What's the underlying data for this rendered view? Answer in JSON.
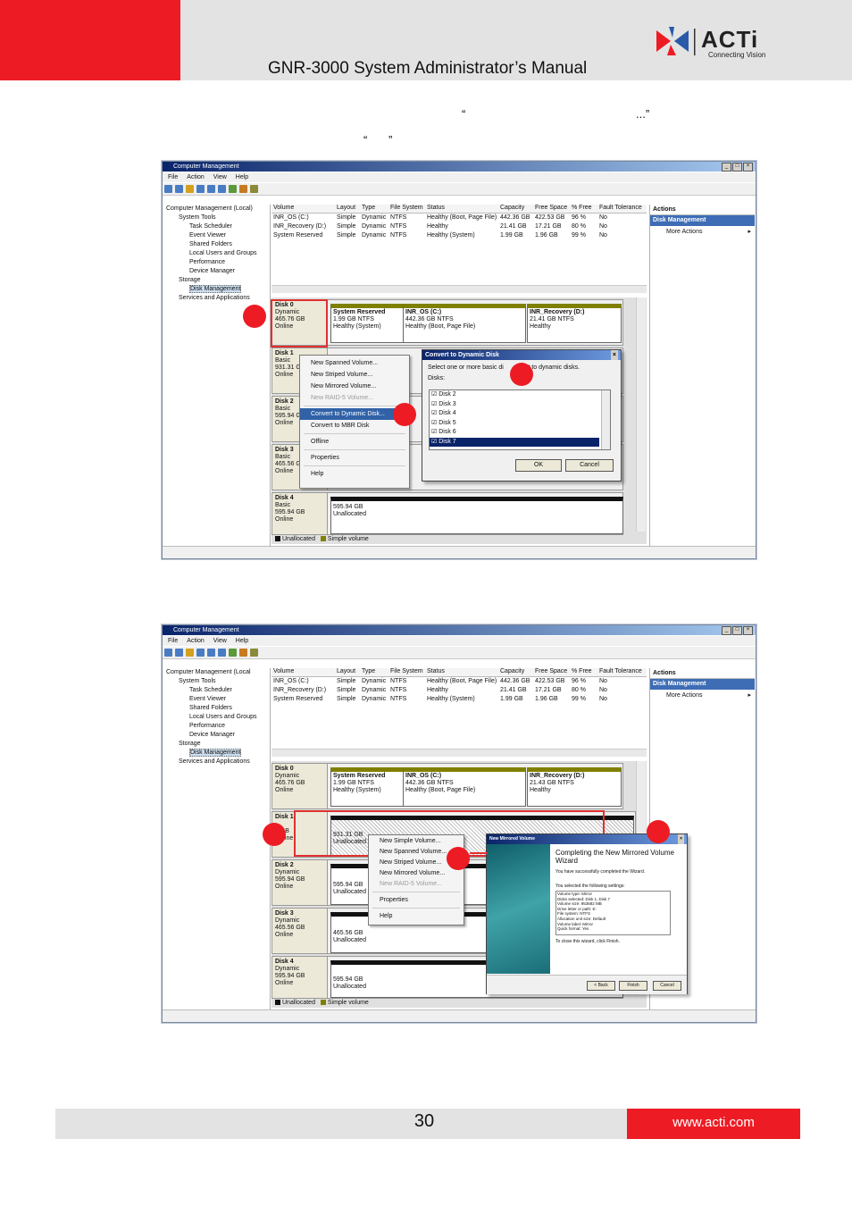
{
  "header": {
    "title": "GNR-3000 System Administrator’s Manual"
  },
  "logo": {
    "brand": "ACTi",
    "tagline": "Connecting Vision"
  },
  "body_text": {
    "open_quote_1": "“",
    "close_quote_1": "...”",
    "open_quote_2": "“",
    "close_quote_2": "”"
  },
  "footer": {
    "page_number": "30",
    "url": "www.acti.com"
  },
  "screenshot1": {
    "window_title": "Computer Management",
    "menu": [
      "File",
      "Action",
      "View",
      "Help"
    ],
    "tree": [
      "Computer Management (Local)",
      "System Tools",
      "Task Scheduler",
      "Event Viewer",
      "Shared Folders",
      "Local Users and Groups",
      "Performance",
      "Device Manager",
      "Storage",
      "Disk Management",
      "Services and Applications"
    ],
    "columns": [
      "Volume",
      "Layout",
      "Type",
      "File System",
      "Status",
      "Capacity",
      "Free Space",
      "% Free",
      "Fault Tolerance"
    ],
    "rows": [
      [
        "INR_OS (C:)",
        "Simple",
        "Dynamic",
        "NTFS",
        "Healthy (Boot, Page File)",
        "442.36 GB",
        "422.53 GB",
        "96 %",
        "No"
      ],
      [
        "INR_Recovery (D:)",
        "Simple",
        "Dynamic",
        "NTFS",
        "Healthy",
        "21.41 GB",
        "17.21 GB",
        "80 %",
        "No"
      ],
      [
        "System Reserved",
        "Simple",
        "Dynamic",
        "NTFS",
        "Healthy (System)",
        "1.99 GB",
        "1.96 GB",
        "99 %",
        "No"
      ]
    ],
    "actions": {
      "header": "Actions",
      "selected": "Disk Management",
      "more": "More Actions"
    },
    "disk0": {
      "name": "Disk 0",
      "type": "Dynamic",
      "size": "465.76 GB",
      "status": "Online",
      "parts": [
        {
          "name": "System Reserved",
          "size": "1.99 GB NTFS",
          "status": "Healthy (System)"
        },
        {
          "name": "INR_OS (C:)",
          "size": "442.36 GB NTFS",
          "status": "Healthy (Boot, Page File)"
        },
        {
          "name": "INR_Recovery (D:)",
          "size": "21.41 GB NTFS",
          "status": "Healthy"
        }
      ]
    },
    "disk1": {
      "name": "Disk 1",
      "type": "Basic",
      "size": "931.31 G",
      "status": "Online"
    },
    "disk2": {
      "name": "Disk 2",
      "type": "Basic",
      "size": "595.94 G",
      "status": "Online"
    },
    "disk3": {
      "name": "Disk 3",
      "type": "Basic",
      "size": "465.56 G",
      "status": "Online"
    },
    "disk4": {
      "name": "Disk 4",
      "type": "Basic",
      "size": "595.94 GB",
      "status": "Online",
      "part_size": "595.94 GB",
      "part_status": "Unallocated"
    },
    "context_menu": [
      "New Spanned Volume...",
      "New Striped Volume...",
      "New Mirrored Volume...",
      "New RAID-5 Volume...",
      "Convert to Dynamic Disk...",
      "Convert to MBR Disk",
      "Offline",
      "Properties",
      "Help"
    ],
    "dialog": {
      "title": "Convert to Dynamic Disk",
      "prompt": "Select one or more basic di",
      "prompt_tail": "nvert to dynamic disks.",
      "disks_label": "Disks:",
      "disks": [
        "Disk 2",
        "Disk 3",
        "Disk 4",
        "Disk 5",
        "Disk 6",
        "Disk 7"
      ],
      "ok": "OK",
      "cancel": "Cancel"
    },
    "legend": [
      "Unallocated",
      "Simple volume"
    ]
  },
  "screenshot2": {
    "window_title": "Computer Management",
    "menu": [
      "File",
      "Action",
      "View",
      "Help"
    ],
    "tree": [
      "Computer Management (Local",
      "System Tools",
      "Task Scheduler",
      "Event Viewer",
      "Shared Folders",
      "Local Users and Groups",
      "Performance",
      "Device Manager",
      "Storage",
      "Disk Management",
      "Services and Applications"
    ],
    "columns": [
      "Volume",
      "Layout",
      "Type",
      "File System",
      "Status",
      "Capacity",
      "Free Space",
      "% Free",
      "Fault Tolerance"
    ],
    "rows": [
      [
        "INR_OS (C:)",
        "Simple",
        "Dynamic",
        "NTFS",
        "Healthy (Boot, Page File)",
        "442.36 GB",
        "422.53 GB",
        "96 %",
        "No"
      ],
      [
        "INR_Recovery (D:)",
        "Simple",
        "Dynamic",
        "NTFS",
        "Healthy",
        "21.41 GB",
        "17.21 GB",
        "80 %",
        "No"
      ],
      [
        "System Reserved",
        "Simple",
        "Dynamic",
        "NTFS",
        "Healthy (System)",
        "1.99 GB",
        "1.96 GB",
        "99 %",
        "No"
      ]
    ],
    "actions": {
      "header": "Actions",
      "selected": "Disk Management",
      "more": "More Actions"
    },
    "disk0": {
      "name": "Disk 0",
      "type": "Dynamic",
      "size": "465.76 GB",
      "status": "Online",
      "parts": [
        {
          "name": "System Reserved",
          "size": "1.99 GB NTFS",
          "status": "Healthy (System)"
        },
        {
          "name": "INR_OS (C:)",
          "size": "442.36 GB NTFS",
          "status": "Healthy (Boot, Page File)"
        },
        {
          "name": "INR_Recovery (D:)",
          "size": "21.43 GB NTFS",
          "status": "Healthy"
        }
      ]
    },
    "disk1": {
      "name": "Disk 1",
      "size": "3 GB",
      "status": "Online",
      "part_size": "931.31 GB",
      "part_status": "Unallocated"
    },
    "disk2": {
      "name": "Disk 2",
      "type": "Dynamic",
      "size": "595.94 GB",
      "status": "Online",
      "part_size": "595.94 GB",
      "part_status": "Unallocated"
    },
    "disk3": {
      "name": "Disk 3",
      "type": "Dynamic",
      "size": "465.56 GB",
      "status": "Online",
      "part_size": "465.56 GB",
      "part_status": "Unallocated"
    },
    "disk4": {
      "name": "Disk 4",
      "type": "Dynamic",
      "size": "595.94 GB",
      "status": "Online",
      "part_size": "595.94 GB",
      "part_status": "Unallocated"
    },
    "context_menu": [
      "New Simple Volume...",
      "New Spanned Volume...",
      "New Striped Volume...",
      "New Mirrored Volume...",
      "New RAID-5 Volume...",
      "Properties",
      "Help"
    ],
    "wizard": {
      "title": "New Mirrored Volume",
      "heading": "Completing the New Mirrored Volume Wizard",
      "line1": "You have successfully completed the Wizard.",
      "line2": "You selected the following settings:",
      "settings": [
        "Volume type: Mirror",
        "Disks selected: Disk 1, Disk 7",
        "Volume size: 953682 MB",
        "Drive letter or path: E:",
        "File system: NTFS",
        "Allocation unit size: Default",
        "Volume label: Mirror",
        "Quick format: Yes"
      ],
      "close_hint": "To close this wizard, click Finish.",
      "back": "< Back",
      "finish": "Finish",
      "cancel": "Cancel"
    },
    "legend": [
      "Unallocated",
      "Simple volume"
    ]
  }
}
